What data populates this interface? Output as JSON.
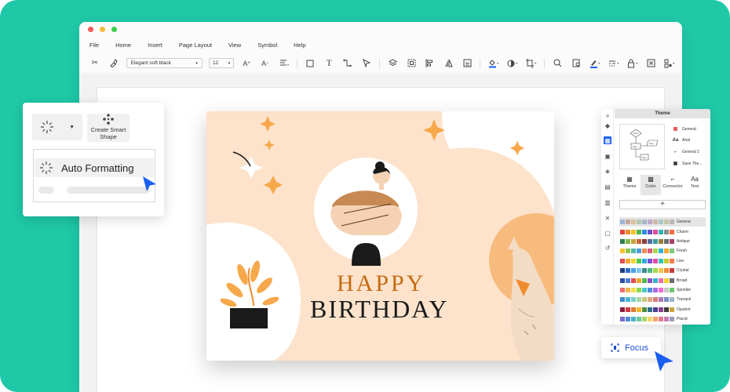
{
  "colors": {
    "background": "#1fc9a8",
    "accent_blue": "#1b5ff0",
    "card_bg": "#fde3cb",
    "orange": "#f5a24a"
  },
  "window": {
    "menu": [
      "File",
      "Home",
      "Insert",
      "Page Layout",
      "View",
      "Symbol",
      "Help"
    ],
    "toolbar": {
      "font_name": "Elegant soft black",
      "font_size": "12"
    }
  },
  "card": {
    "line1": "HAPPY",
    "line2": "BIRTHDAY"
  },
  "left_panel": {
    "smart_shape_label": "Create Smart Shape",
    "auto_formatting_label": "Auto Formatting"
  },
  "theme_panel": {
    "title": "Theme",
    "options": [
      {
        "icon": "palette-icon",
        "label": "General"
      },
      {
        "icon": "font-icon",
        "label": "Arial"
      },
      {
        "icon": "connector-icon",
        "label": "General 1"
      },
      {
        "icon": "save-icon",
        "label": "Save The..."
      }
    ],
    "tabs": [
      "Theme",
      "Color",
      "Connector",
      "Text"
    ],
    "active_tab": "Color",
    "add_label": "+",
    "palettes": [
      {
        "name": "General",
        "colors": [
          "#9fb8d8",
          "#c8a8a0",
          "#d8c0a0",
          "#b0c8b0",
          "#a8b8c8",
          "#c0a8c8",
          "#d0b8a8",
          "#a8c8c8",
          "#c8c8a8",
          "#b8b8b8"
        ]
      },
      {
        "name": "Charm",
        "colors": [
          "#e0443c",
          "#f08c2c",
          "#f4c430",
          "#4cb84c",
          "#2c8ce0",
          "#6c4cc8",
          "#e04c9c",
          "#34b4b4",
          "#8c8c8c",
          "#f06c3c"
        ]
      },
      {
        "name": "Antique",
        "colors": [
          "#2c7c4c",
          "#7cb84c",
          "#c8a43c",
          "#c8643c",
          "#8c3c3c",
          "#4c6c9c",
          "#3c9c9c",
          "#9c7c3c",
          "#6c6c6c",
          "#a83c6c"
        ]
      },
      {
        "name": "Fresh",
        "colors": [
          "#f4c430",
          "#8cc84c",
          "#4cb8a8",
          "#4c9ce0",
          "#f08c4c",
          "#e05c7c",
          "#a8d84c",
          "#30b4d8",
          "#f4a830",
          "#7cc87c"
        ]
      },
      {
        "name": "Live",
        "colors": [
          "#e04c4c",
          "#f4a430",
          "#f4d430",
          "#4cc84c",
          "#30a8e0",
          "#7c4cd8",
          "#e04ca8",
          "#30c8b4",
          "#c8c830",
          "#f07c4c"
        ]
      },
      {
        "name": "Crystal",
        "colors": [
          "#1c3c7c",
          "#2c6cc8",
          "#4ca4e8",
          "#7cc8f0",
          "#3c8c8c",
          "#4cb884",
          "#a4d84c",
          "#f4c44c",
          "#f08c3c",
          "#c83c3c"
        ]
      },
      {
        "name": "Broad",
        "colors": [
          "#2c4ca8",
          "#4c7cd8",
          "#e04c4c",
          "#f4a430",
          "#4cb84c",
          "#8c4cc8",
          "#30b4c8",
          "#f06ca8",
          "#f4d430",
          "#6c6c6c"
        ]
      },
      {
        "name": "Sprinkle",
        "colors": [
          "#f06c6c",
          "#f4b44c",
          "#f4e04c",
          "#8cd84c",
          "#4cc8c8",
          "#4c8ce0",
          "#a86ce0",
          "#f06cc8",
          "#c8c8c8",
          "#6cc86c"
        ]
      },
      {
        "name": "Tranquil",
        "colors": [
          "#3c8cc8",
          "#4cb4d8",
          "#7cd0c8",
          "#a8d8a8",
          "#c8c87c",
          "#e0a87c",
          "#d87c7c",
          "#a87cb8",
          "#7c8cc8",
          "#9cb4c8"
        ]
      },
      {
        "name": "Opulent",
        "colors": [
          "#8c1c3c",
          "#c83c3c",
          "#e07c2c",
          "#f4b42c",
          "#4c8c3c",
          "#2c6c8c",
          "#4c3c8c",
          "#8c3c8c",
          "#3c3c3c",
          "#c8a43c"
        ]
      },
      {
        "name": "Placid",
        "colors": [
          "#7c6cc8",
          "#4c8cd8",
          "#4cb4c8",
          "#6cc89c",
          "#a8d86c",
          "#f4d46c",
          "#f4a46c",
          "#e07c8c",
          "#c87cb4",
          "#9c9cb4"
        ]
      }
    ]
  },
  "focus": {
    "label": "Focus"
  }
}
